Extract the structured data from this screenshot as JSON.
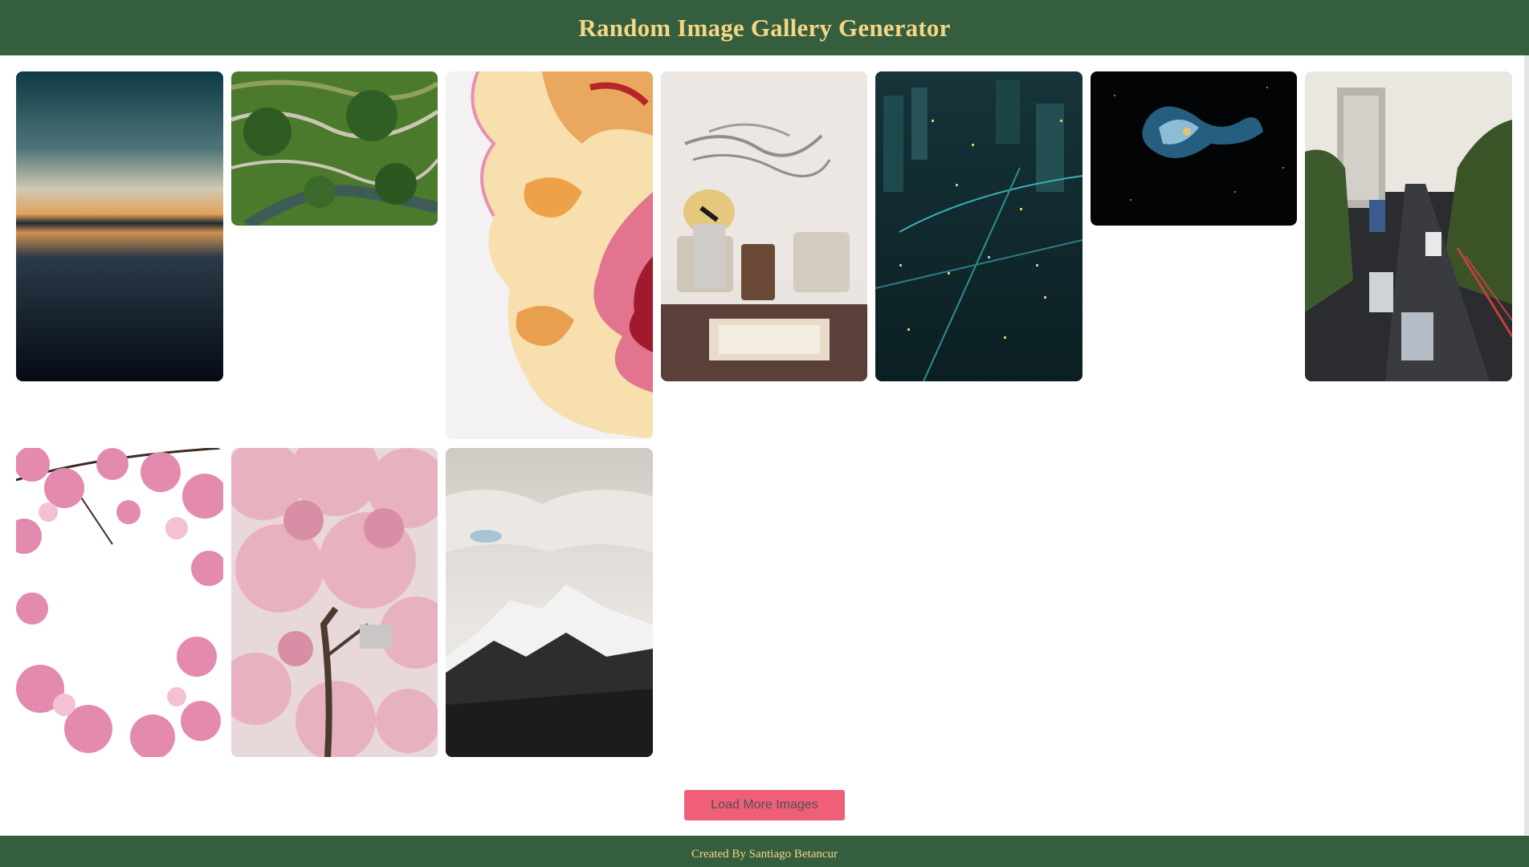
{
  "header": {
    "title": "Random Image Gallery Generator"
  },
  "gallery": {
    "images": [
      {
        "name": "sunset-horizon-image"
      },
      {
        "name": "rice-terraces-aerial-image"
      },
      {
        "name": "fluid-abstract-art-image"
      },
      {
        "name": "sculpture-lounge-interior-image"
      },
      {
        "name": "night-city-aerial-image"
      },
      {
        "name": "galaxy-nebula-image"
      },
      {
        "name": "city-traffic-highway-image"
      },
      {
        "name": "cherry-blossom-branches-image"
      },
      {
        "name": "cherry-blossom-tree-image"
      },
      {
        "name": "snowy-mountain-image"
      }
    ]
  },
  "actions": {
    "load_more_label": "Load More Images"
  },
  "footer": {
    "credit": "Created By Santiago Betancur"
  },
  "colors": {
    "brand_green": "#355e3f",
    "brand_gold": "#f5d685",
    "button_pink": "#f05f78"
  }
}
